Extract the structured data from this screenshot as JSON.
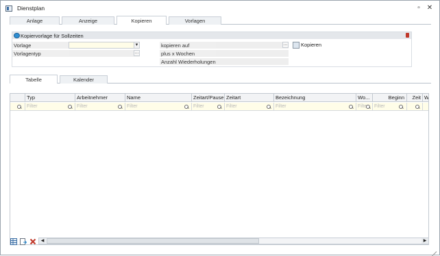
{
  "window": {
    "title": "Dienstplan",
    "minimize": "▫",
    "close": "✕"
  },
  "main_tabs": [
    {
      "label": "Anlage"
    },
    {
      "label": "Anzeige"
    },
    {
      "label": "Kopieren"
    },
    {
      "label": "Vorlagen"
    }
  ],
  "active_main_tab": "Kopieren",
  "group": {
    "title": "Kopiervorlage für Sollzeiten",
    "fields": {
      "vorlage": {
        "label": "Vorlage",
        "value": ""
      },
      "vorlagentyp": {
        "label": "Vorlagentyp",
        "value": ""
      },
      "kopieren_auf": {
        "label": "kopieren auf",
        "value": ""
      },
      "plus_wochen": {
        "label": "plus x Wochen",
        "value": ""
      },
      "wiederholungen": {
        "label": "Anzahl Wiederholungen",
        "value": ""
      }
    },
    "copy_button": "Kopieren"
  },
  "sub_tabs": [
    {
      "label": "Tabelle"
    },
    {
      "label": "Kalender"
    }
  ],
  "active_sub_tab": "Tabelle",
  "grid": {
    "columns": [
      {
        "label": ""
      },
      {
        "label": "Typ"
      },
      {
        "label": "Arbeitnehmer"
      },
      {
        "label": "Name"
      },
      {
        "label": "Zeitart/Pause"
      },
      {
        "label": "Zeitart"
      },
      {
        "label": "Bezeichnung"
      },
      {
        "label": "Wo..."
      },
      {
        "label": "Beginn"
      },
      {
        "label": "Zeit"
      },
      {
        "label": "W"
      }
    ],
    "filter_placeholder": "Filter",
    "rows": []
  },
  "toolbar": {
    "icons": [
      "grid-config-icon",
      "export-icon",
      "delete-icon"
    ]
  },
  "colors": {
    "filter_bg": "#fffde8",
    "header_bg": "#f2f3f5",
    "accent": "#2f8fd3",
    "delete": "#c0392b"
  }
}
